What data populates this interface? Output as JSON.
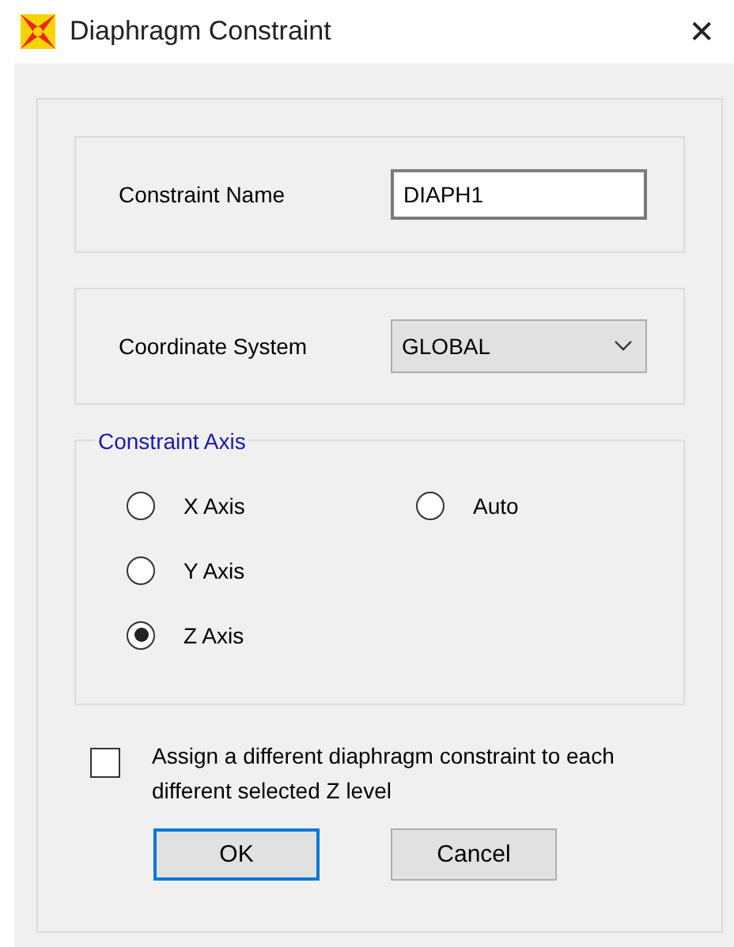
{
  "window": {
    "title": "Diaphragm Constraint",
    "close": "✕"
  },
  "constraint_name": {
    "label": "Constraint Name",
    "value": "DIAPH1"
  },
  "coordinate_system": {
    "label": "Coordinate System",
    "value": "GLOBAL"
  },
  "constraint_axis": {
    "title": "Constraint Axis",
    "options": [
      {
        "label": "X Axis",
        "selected": false
      },
      {
        "label": "Auto",
        "selected": false
      },
      {
        "label": "Y Axis",
        "selected": false
      },
      {
        "label": "Z Axis",
        "selected": true
      }
    ]
  },
  "assign_checkbox": {
    "label": "Assign a different diaphragm constraint to each different selected Z level",
    "checked": false
  },
  "buttons": [
    {
      "label": "OK",
      "default": true
    },
    {
      "label": "Cancel",
      "default": false
    }
  ]
}
